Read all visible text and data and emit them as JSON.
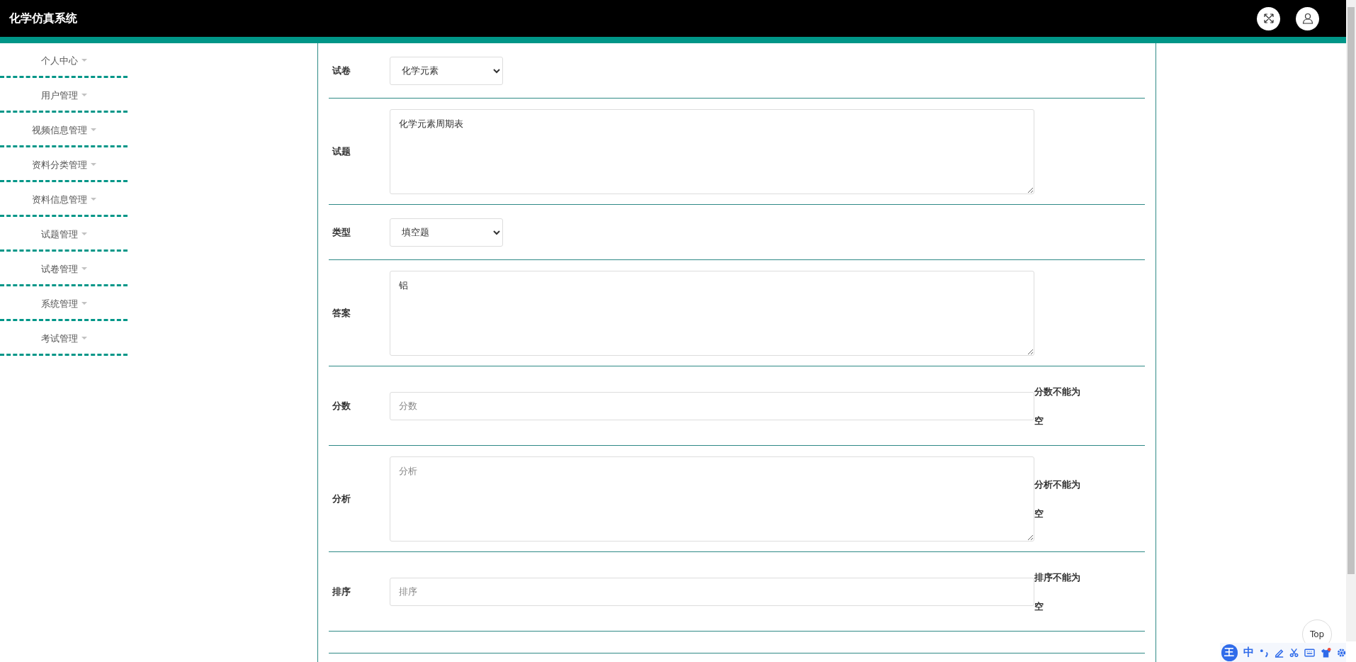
{
  "header": {
    "title": "化学仿真系统"
  },
  "sidebar": {
    "items": [
      {
        "label": "个人中心"
      },
      {
        "label": "用户管理"
      },
      {
        "label": "视频信息管理"
      },
      {
        "label": "资料分类管理"
      },
      {
        "label": "资料信息管理"
      },
      {
        "label": "试题管理"
      },
      {
        "label": "试卷管理"
      },
      {
        "label": "系统管理"
      },
      {
        "label": "考试管理"
      }
    ]
  },
  "form": {
    "fields": [
      {
        "label": "试卷",
        "kind": "select",
        "value": "化学元素"
      },
      {
        "label": "试题",
        "kind": "textarea",
        "value": "化学元素周期表"
      },
      {
        "label": "类型",
        "kind": "select",
        "value": "填空题"
      },
      {
        "label": "答案",
        "kind": "textarea",
        "value": "铝"
      },
      {
        "label": "分数",
        "kind": "input",
        "placeholder": "分数",
        "error": "分数不能为空"
      },
      {
        "label": "分析",
        "kind": "textarea",
        "placeholder": "分析",
        "error": "分析不能为空"
      },
      {
        "label": "排序",
        "kind": "input",
        "placeholder": "排序",
        "error": "排序不能为空"
      }
    ]
  },
  "top_button": {
    "label": "Top"
  },
  "ime_toolbar": {
    "logo": "王",
    "mode": "中"
  }
}
